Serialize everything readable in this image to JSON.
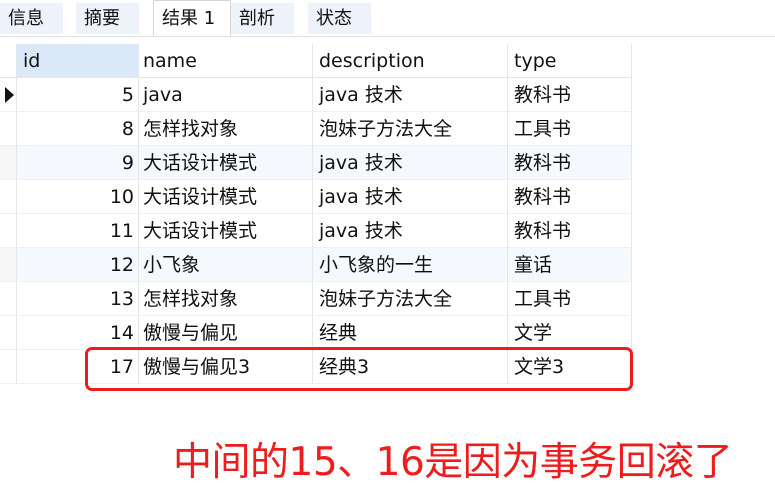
{
  "tabs": [
    {
      "label": "信息",
      "active": false
    },
    {
      "label": "摘要",
      "active": false
    },
    {
      "label": "结果 1",
      "active": true
    },
    {
      "label": "剖析",
      "active": false
    },
    {
      "label": "状态",
      "active": false
    }
  ],
  "grid": {
    "columns": [
      "id",
      "name",
      "description",
      "type"
    ],
    "rows": [
      {
        "id": "5",
        "name": "java",
        "description": "java 技术",
        "type": "教科书"
      },
      {
        "id": "8",
        "name": "怎样找对象",
        "description": "泡妹子方法大全",
        "type": "工具书"
      },
      {
        "id": "9",
        "name": "大话设计模式",
        "description": "java 技术",
        "type": "教科书"
      },
      {
        "id": "10",
        "name": "大话设计模式",
        "description": "java 技术",
        "type": "教科书"
      },
      {
        "id": "11",
        "name": "大话设计模式",
        "description": "java 技术",
        "type": "教科书"
      },
      {
        "id": "12",
        "name": "小飞象",
        "description": "小飞象的一生",
        "type": "童话"
      },
      {
        "id": "13",
        "name": "怎样找对象",
        "description": "泡妹子方法大全",
        "type": "工具书"
      },
      {
        "id": "14",
        "name": "傲慢与偏见",
        "description": "经典",
        "type": "文学"
      },
      {
        "id": "17",
        "name": "傲慢与偏见3",
        "description": "经典3",
        "type": "文学3"
      }
    ]
  },
  "annotation": {
    "text": "中间的15、16是因为事务回滚了",
    "color": "#ee1c1c"
  }
}
